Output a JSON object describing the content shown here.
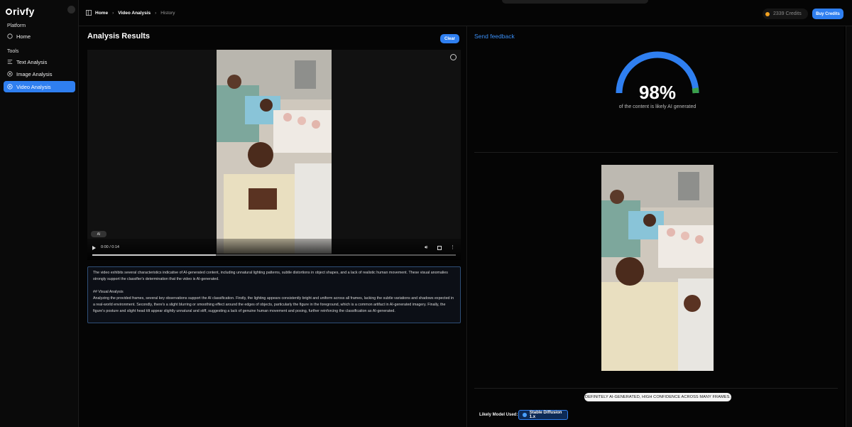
{
  "app": {
    "logo": "rivfy"
  },
  "sidebar": {
    "section_platform": "Platform",
    "home_label": "Home",
    "section_tools": "Tools",
    "items": [
      {
        "label": "Text Analysis"
      },
      {
        "label": "Image Analysis"
      },
      {
        "label": "Video Analysis"
      }
    ],
    "active_item": "Video Analysis"
  },
  "breadcrumb": {
    "home": "Home",
    "current": "Video Analysis",
    "history": "History"
  },
  "header": {
    "credits": "2339 Credits",
    "buy_label": "Buy Credits"
  },
  "main": {
    "title": "Analysis Results",
    "clear_label": "Clear",
    "video": {
      "ai_badge": "AI",
      "time": "0:00 / 0:14",
      "progress": 0.34
    },
    "analysis_text": {
      "summary": "The video exhibits several characteristics indicative of AI-generated content, including unnatural lighting patterns, subtle distortions in object shapes, and a lack of realistic human movement. These visual anomalies strongly support the classifier's determination that the video is AI-generated.",
      "heading": "## Visual Analysis",
      "body": "Analyzing the provided frames, several key observations support the AI classification. Firstly, the lighting appears consistently bright and uniform across all frames, lacking the subtle variations and shadows expected in a real-world environment. Secondly, there's a slight blurring or smoothing effect around the edges of objects, particularly the figure in the foreground, which is a common artifact in AI-generated imagery. Finally, the figure's posture and slight head tilt appear slightly unnatural and stiff, suggesting a lack of genuine human movement and posing, further reinforcing the classification as AI-generated."
    }
  },
  "result": {
    "feedback_label": "Send feedback",
    "percentage_value": 98,
    "percentage": "98%",
    "caption": "of the content is likely AI generated",
    "verdict": "DEFINITELY AI-GENERATED, HIGH CONFIDENCE ACROSS MANY FRAMES.",
    "model_label": "Likely Model Used:",
    "model_name": "Stable Diffusion 1.x"
  },
  "colors": {
    "accent": "#2f7ff0",
    "gauge_end": "#3aa04a",
    "coin": "#f0a020"
  }
}
